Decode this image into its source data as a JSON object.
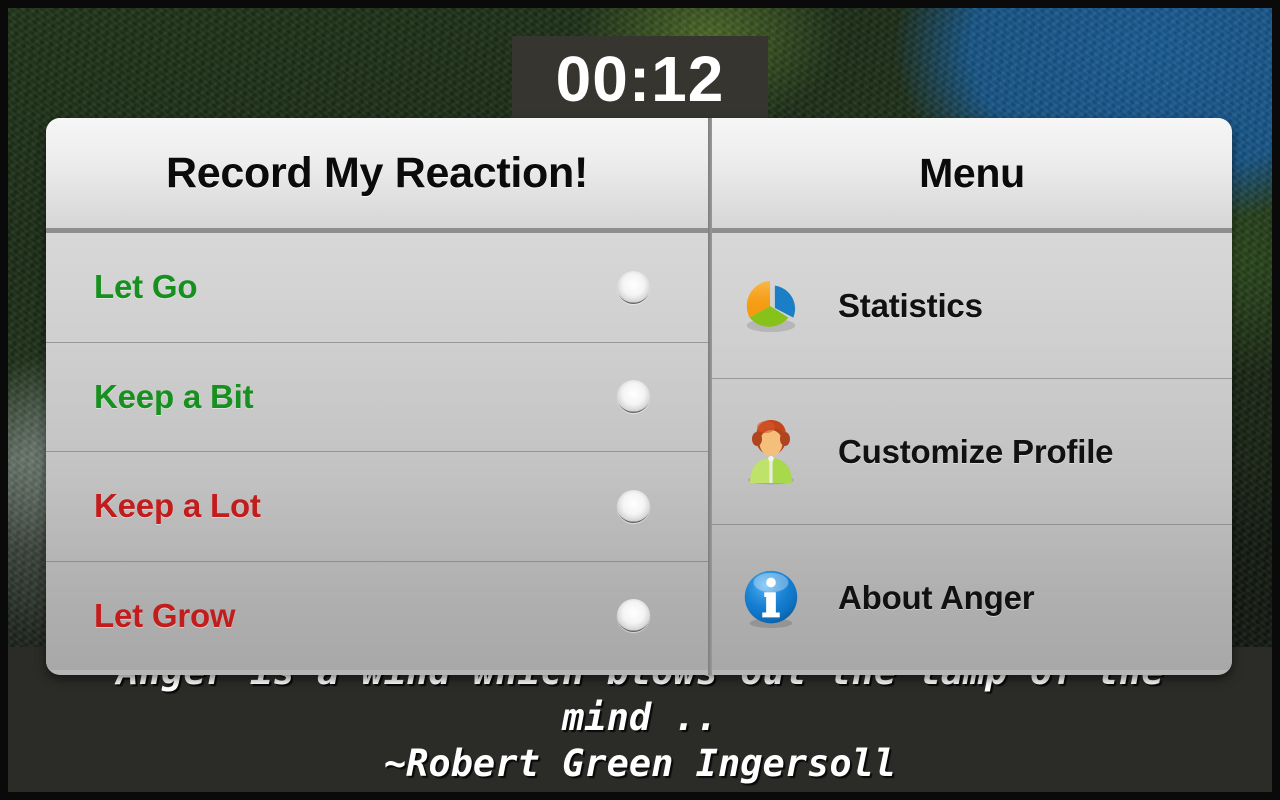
{
  "app": {
    "timer": "00:12"
  },
  "left_panel": {
    "title": "Record My Reaction!",
    "rows": [
      {
        "label": "Let Go",
        "color": "#18901f",
        "selected": false
      },
      {
        "label": "Keep a Bit",
        "color": "#18901f",
        "selected": false
      },
      {
        "label": "Keep a Lot",
        "color": "#c21c1c",
        "selected": false
      },
      {
        "label": "Let Grow",
        "color": "#c21c1c",
        "selected": false
      }
    ]
  },
  "right_panel": {
    "title": "Menu",
    "items": [
      {
        "label": "Statistics",
        "icon": "pie-chart-icon"
      },
      {
        "label": "Customize Profile",
        "icon": "person-profile-icon"
      },
      {
        "label": "About Anger",
        "icon": "info-circle-icon"
      }
    ]
  },
  "quote": {
    "line1": "Anger is a wind which blows out the lamp of the",
    "line2": "mind ..",
    "attribution": "~Robert Green Ingersoll"
  },
  "colors": {
    "positive": "#18901f",
    "negative": "#c21c1c",
    "timer_bg": "#36352f",
    "panel_bg": "#b6b6b6",
    "quote_bg": "#2b2b28"
  }
}
